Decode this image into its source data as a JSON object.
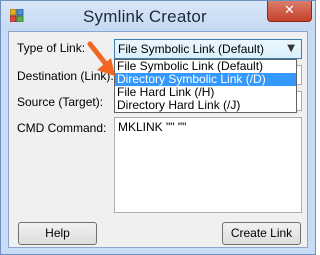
{
  "window": {
    "title": "Symlink Creator",
    "close_glyph": "✕"
  },
  "form": {
    "type_label": "Type of Link:",
    "destination_label": "Destination (Link):",
    "source_label": "Source (Target):",
    "cmd_label": "CMD Command:",
    "type_selected": "File Symbolic Link (Default)",
    "destination_value": "",
    "source_value": "",
    "cmd_value": "MKLINK \"\" \"\""
  },
  "dropdown": {
    "options": [
      "File Symbolic Link (Default)",
      "Directory Symbolic Link (/D)",
      "File Hard Link (/H)",
      "Directory Hard Link (/J)"
    ],
    "highlighted_index": 1
  },
  "buttons": {
    "help": "Help",
    "create": "Create Link"
  },
  "colors": {
    "selection": "#3399ff",
    "arrow": "#f26522",
    "close": "#c7402a"
  }
}
